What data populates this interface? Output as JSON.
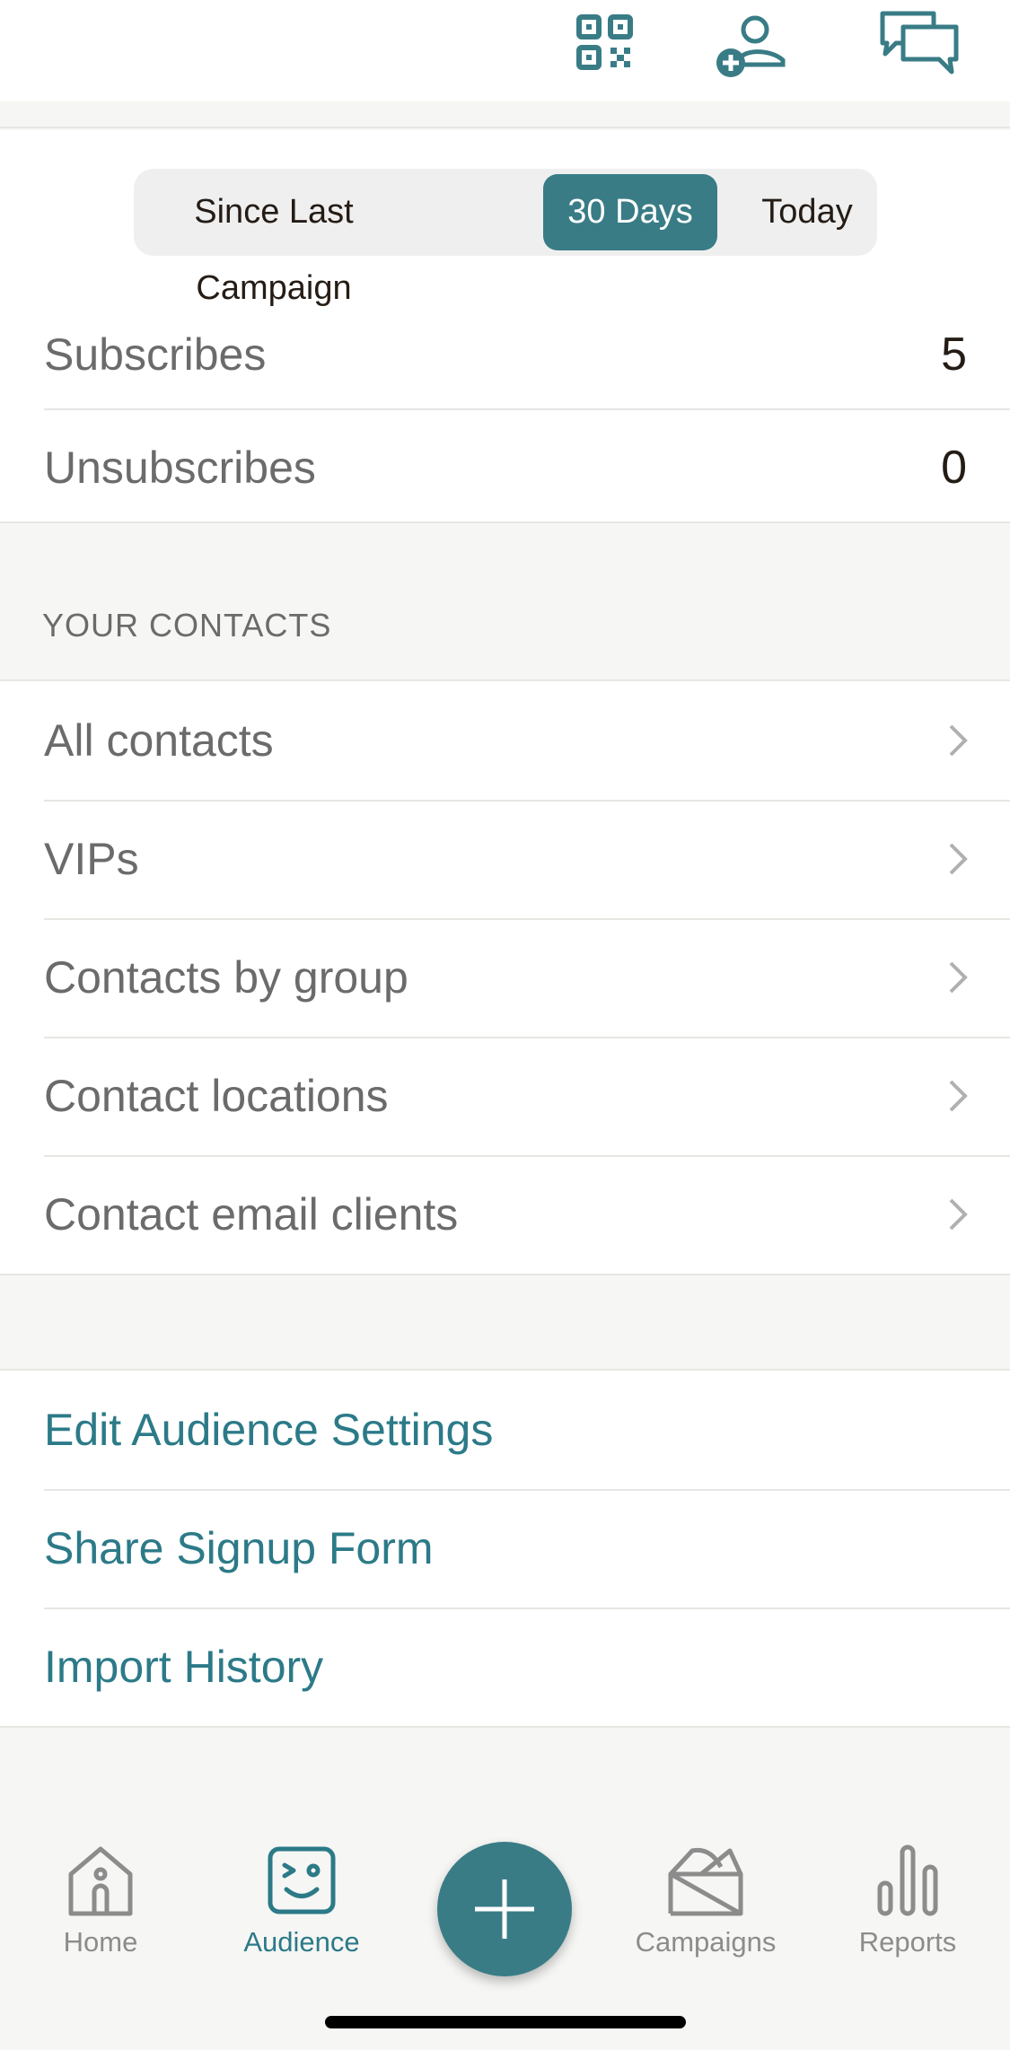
{
  "header": {
    "icons": [
      "qr-code-icon",
      "add-contact-icon",
      "chat-icon"
    ]
  },
  "filter": {
    "options": [
      "Since Last Campaign",
      "30 Days",
      "Today"
    ],
    "selected": "30 Days"
  },
  "stats": {
    "subscribes_label": "Subscribes",
    "subscribes_value": "5",
    "unsubscribes_label": "Unsubscribes",
    "unsubscribes_value": "0"
  },
  "contacts": {
    "section_title": "YOUR CONTACTS",
    "items": [
      "All contacts",
      "VIPs",
      "Contacts by group",
      "Contact locations",
      "Contact email clients"
    ]
  },
  "actions": {
    "items": [
      "Edit Audience Settings",
      "Share Signup Form",
      "Import History"
    ]
  },
  "tabbar": {
    "tabs": [
      "Home",
      "Audience",
      "Campaigns",
      "Reports"
    ],
    "active": "Audience"
  },
  "colors": {
    "accent": "#397c86",
    "link": "#2c7a88",
    "background": "#f6f6f4"
  }
}
